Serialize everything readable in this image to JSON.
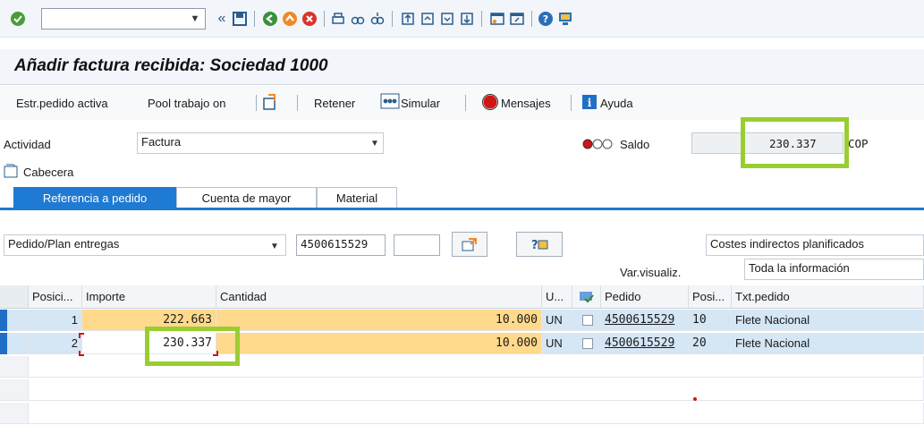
{
  "toolbar": {
    "command_value": "",
    "back_glyph": "«",
    "icons": [
      "enter-icon",
      "save-icon",
      "back-icon",
      "exit-icon",
      "cancel-icon",
      "print-icon",
      "find-icon",
      "find-next-icon",
      "first-page-icon",
      "prev-page-icon",
      "next-page-icon",
      "last-page-icon",
      "new-session-icon",
      "shortcut-icon",
      "help-icon",
      "customize-icon"
    ]
  },
  "title": "Añadir factura recibida: Sociedad 1000",
  "app_toolbar": {
    "estr_pedido": "Estr.pedido activa",
    "pool_trabajo": "Pool trabajo on",
    "retener": "Retener",
    "simular": "Simular",
    "mensajes": "Mensajes",
    "ayuda": "Ayuda"
  },
  "header": {
    "actividad_label": "Actividad",
    "actividad_value": "Factura",
    "saldo_label": "Saldo",
    "saldo_value": "230.337",
    "currency": "COP",
    "cabecera": "Cabecera"
  },
  "tabs": [
    {
      "label": "Referencia a pedido",
      "active": true
    },
    {
      "label": "Cuenta de mayor",
      "active": false
    },
    {
      "label": "Material",
      "active": false
    }
  ],
  "ref": {
    "type_value": "Pedido/Plan entregas",
    "order_number": "4500615529",
    "extra_value": "",
    "costs_option": "Costes indirectos planificados",
    "var_label": "Var.visualiz.",
    "var_value": "Toda la información"
  },
  "table": {
    "headers": [
      "Posici...",
      "Importe",
      "Cantidad",
      "U...",
      "",
      "Pedido",
      "Posi...",
      "Txt.pedido"
    ],
    "rows": [
      {
        "pos": "1",
        "importe": "222.663",
        "cantidad": "10.000",
        "unidad": "UN",
        "pedido": "4500615529",
        "posi": "10",
        "txt": "Flete Nacional"
      },
      {
        "pos": "2",
        "importe": "230.337",
        "cantidad": "10.000",
        "unidad": "UN",
        "pedido": "4500615529",
        "posi": "20",
        "txt": "Flete Nacional"
      }
    ]
  },
  "colors": {
    "accent": "#1f7ad3",
    "highlight_box": "#9acd32",
    "amount_cell": "#ffd98c",
    "selected_row": "#d5e6f5"
  }
}
